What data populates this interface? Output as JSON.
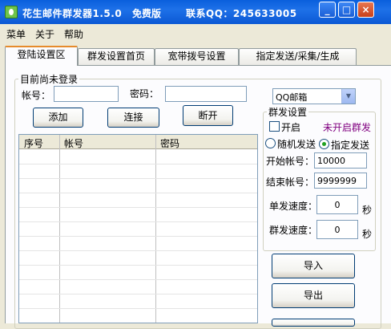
{
  "titlebar": {
    "title": "花生邮件群发器1.5.0",
    "edition": "免费版",
    "contact": "联系QQ：245633005",
    "min": "_",
    "max": "□",
    "close": "×"
  },
  "menu": {
    "items": [
      {
        "label": "菜单"
      },
      {
        "label": "关于"
      },
      {
        "label": "帮助"
      }
    ]
  },
  "tabs": [
    {
      "label": "登陆设置区"
    },
    {
      "label": "群发设置首页"
    },
    {
      "label": "宽带拨号设置"
    },
    {
      "label": "指定发送/采集/生成"
    }
  ],
  "login": {
    "status": "目前尚未登录",
    "account_label": "帐号：",
    "account_value": "",
    "password_label": "密码：",
    "password_value": "",
    "add_button": "添加",
    "connect_button": "连接",
    "disconnect_button": "断开"
  },
  "mail_type": {
    "selected": "QQ邮箱"
  },
  "table": {
    "columns": [
      "序号",
      "帐号",
      "密码"
    ],
    "rows": []
  },
  "send_settings": {
    "legend": "群发设置",
    "enable_label": "开启",
    "enabled": false,
    "status_text": "未开启群发",
    "random_label": "随机发送",
    "specified_label": "指定发送",
    "mode": "specified",
    "start_label": "开始帐号：",
    "start_value": "10000",
    "end_label": "结束帐号：",
    "end_value": "9999999",
    "single_speed_label": "单发速度：",
    "single_speed_value": "0",
    "group_speed_label": "群发速度：",
    "group_speed_value": "0",
    "unit": "秒"
  },
  "actions": {
    "import_button": "导入",
    "export_button": "导出"
  },
  "colors": {
    "titlebar": "#0a5fdc",
    "tab_highlight": "#e68b2c",
    "status_text": "#800080"
  }
}
